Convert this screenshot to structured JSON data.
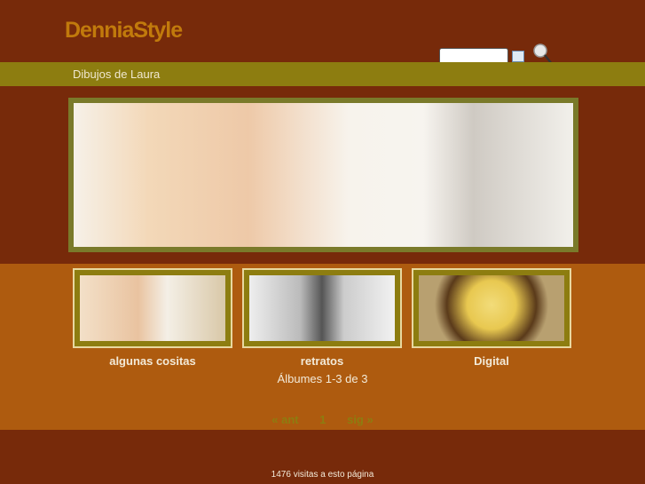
{
  "header": {
    "logo": "DenniaStyle",
    "search_placeholder": ""
  },
  "nav": {
    "title": "Dibujos de Laura"
  },
  "albums": [
    {
      "label": "algunas cositas"
    },
    {
      "label": "retratos"
    },
    {
      "label": "Digital"
    }
  ],
  "album_count": "Álbumes 1-3 de 3",
  "pager": {
    "prev": "« ant",
    "page": "1",
    "next": "sig »"
  },
  "footer": {
    "visits": "1476 visitas a esto página"
  },
  "colors": {
    "background": "#772a0a",
    "nav": "#8d7d10",
    "band": "#ae5b0f",
    "logo": "#c17a0c"
  }
}
